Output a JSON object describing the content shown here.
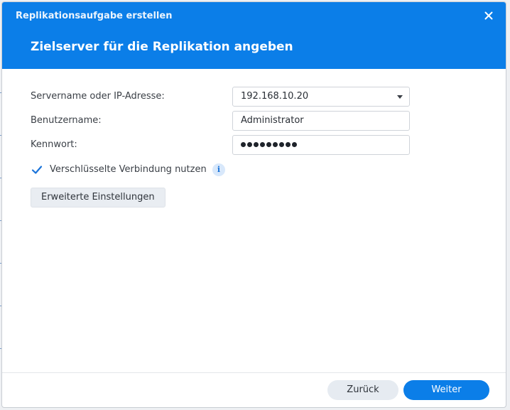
{
  "window": {
    "title": "Replikationsaufgabe erstellen",
    "step_title": "Zielserver für die Replikation angeben"
  },
  "form": {
    "server": {
      "label": "Servername oder IP-Adresse:",
      "value": "192.168.10.20"
    },
    "username": {
      "label": "Benutzername:",
      "value": "Administrator"
    },
    "password": {
      "label": "Kennwort:",
      "masked_length": 9
    },
    "encrypted": {
      "label": "Verschlüsselte Verbindung nutzen",
      "checked": true
    },
    "advanced_button": "Erweiterte Einstellungen"
  },
  "footer": {
    "back_label": "Zurück",
    "next_label": "Weiter"
  },
  "colors": {
    "accent": "#0b7ee8",
    "checkbox": "#1a73d9"
  },
  "icons": {
    "close": "close-icon",
    "dropdown": "chevron-down-icon",
    "checkbox": "checkmark-icon",
    "info": "info-icon"
  }
}
